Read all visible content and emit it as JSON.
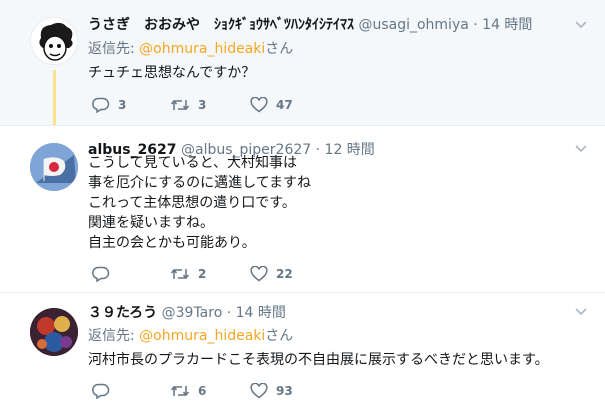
{
  "tweets": [
    {
      "name": "うさぎ　おおみや　ｼｮｸｷﾞｮｳｻﾍﾞﾂﾊﾝﾀｲｼﾃｲﾏｽ",
      "handle": "@usagi_ohmiya",
      "sep": "·",
      "time": "14 時間",
      "reply_prefix": "返信先: ",
      "reply_handle": "@ohmura_hideaki",
      "reply_suffix": "さん",
      "text": [
        "チュチェ思想なんですか？"
      ],
      "replies": "3",
      "retweets": "3",
      "likes": "47"
    },
    {
      "name": "albus_2627",
      "handle": "@albus_piper2627",
      "sep": "·",
      "time": "12 時間",
      "text": [
        "こうして見ていると、大村知事は",
        "事を厄介にするのに邁進してますね",
        "これって主体思想の遣り口です。",
        "関連を疑いますね。",
        "自主の会とかも可能あり。"
      ],
      "replies": "",
      "retweets": "2",
      "likes": "22"
    },
    {
      "name": "３９たろう",
      "handle": "@39Taro",
      "sep": "·",
      "time": "14 時間",
      "reply_prefix": "返信先: ",
      "reply_handle": "@ohmura_hideaki",
      "reply_suffix": "さん",
      "text": [
        "河村市長のプラカードこそ表現の不自由展に展示するべきだと思います。"
      ],
      "replies": "",
      "retweets": "6",
      "likes": "93"
    }
  ],
  "colors": {
    "mention": "#f5a623",
    "thread_line": "#fbe28f",
    "muted": "#657786"
  },
  "icons": [
    "reply-icon",
    "retweet-icon",
    "like-icon",
    "chevron-down-icon"
  ]
}
